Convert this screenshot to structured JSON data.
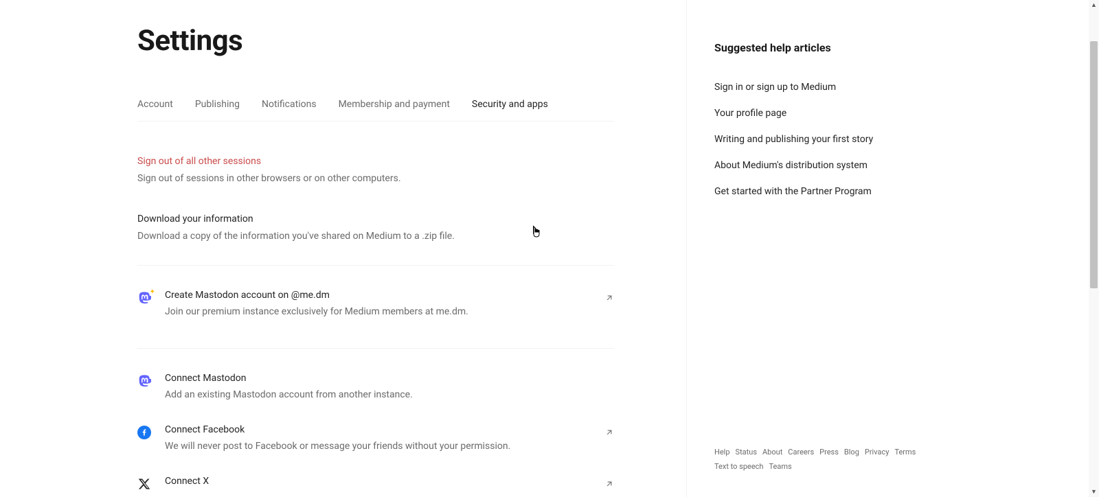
{
  "pageTitle": "Settings",
  "tabs": [
    {
      "label": "Account",
      "active": false
    },
    {
      "label": "Publishing",
      "active": false
    },
    {
      "label": "Notifications",
      "active": false
    },
    {
      "label": "Membership and payment",
      "active": false
    },
    {
      "label": "Security and apps",
      "active": true
    }
  ],
  "signOut": {
    "title": "Sign out of all other sessions",
    "desc": "Sign out of sessions in other browsers or on other computers."
  },
  "download": {
    "title": "Download your information",
    "desc": "Download a copy of the information you've shared on Medium to a .zip file."
  },
  "mastodonCreate": {
    "title": "Create Mastodon account on @me.dm",
    "desc": "Join our premium instance exclusively for Medium members at me.dm."
  },
  "mastodonConnect": {
    "title": "Connect Mastodon",
    "desc": "Add an existing Mastodon account from another instance."
  },
  "facebook": {
    "title": "Connect Facebook",
    "desc": "We will never post to Facebook or message your friends without your permission."
  },
  "x": {
    "title": "Connect X"
  },
  "helpTitle": "Suggested help articles",
  "helpLinks": [
    "Sign in or sign up to Medium",
    "Your profile page",
    "Writing and publishing your first story",
    "About Medium's distribution system",
    "Get started with the Partner Program"
  ],
  "footerLinks": [
    "Help",
    "Status",
    "About",
    "Careers",
    "Press",
    "Blog",
    "Privacy",
    "Terms",
    "Text to speech",
    "Teams"
  ]
}
